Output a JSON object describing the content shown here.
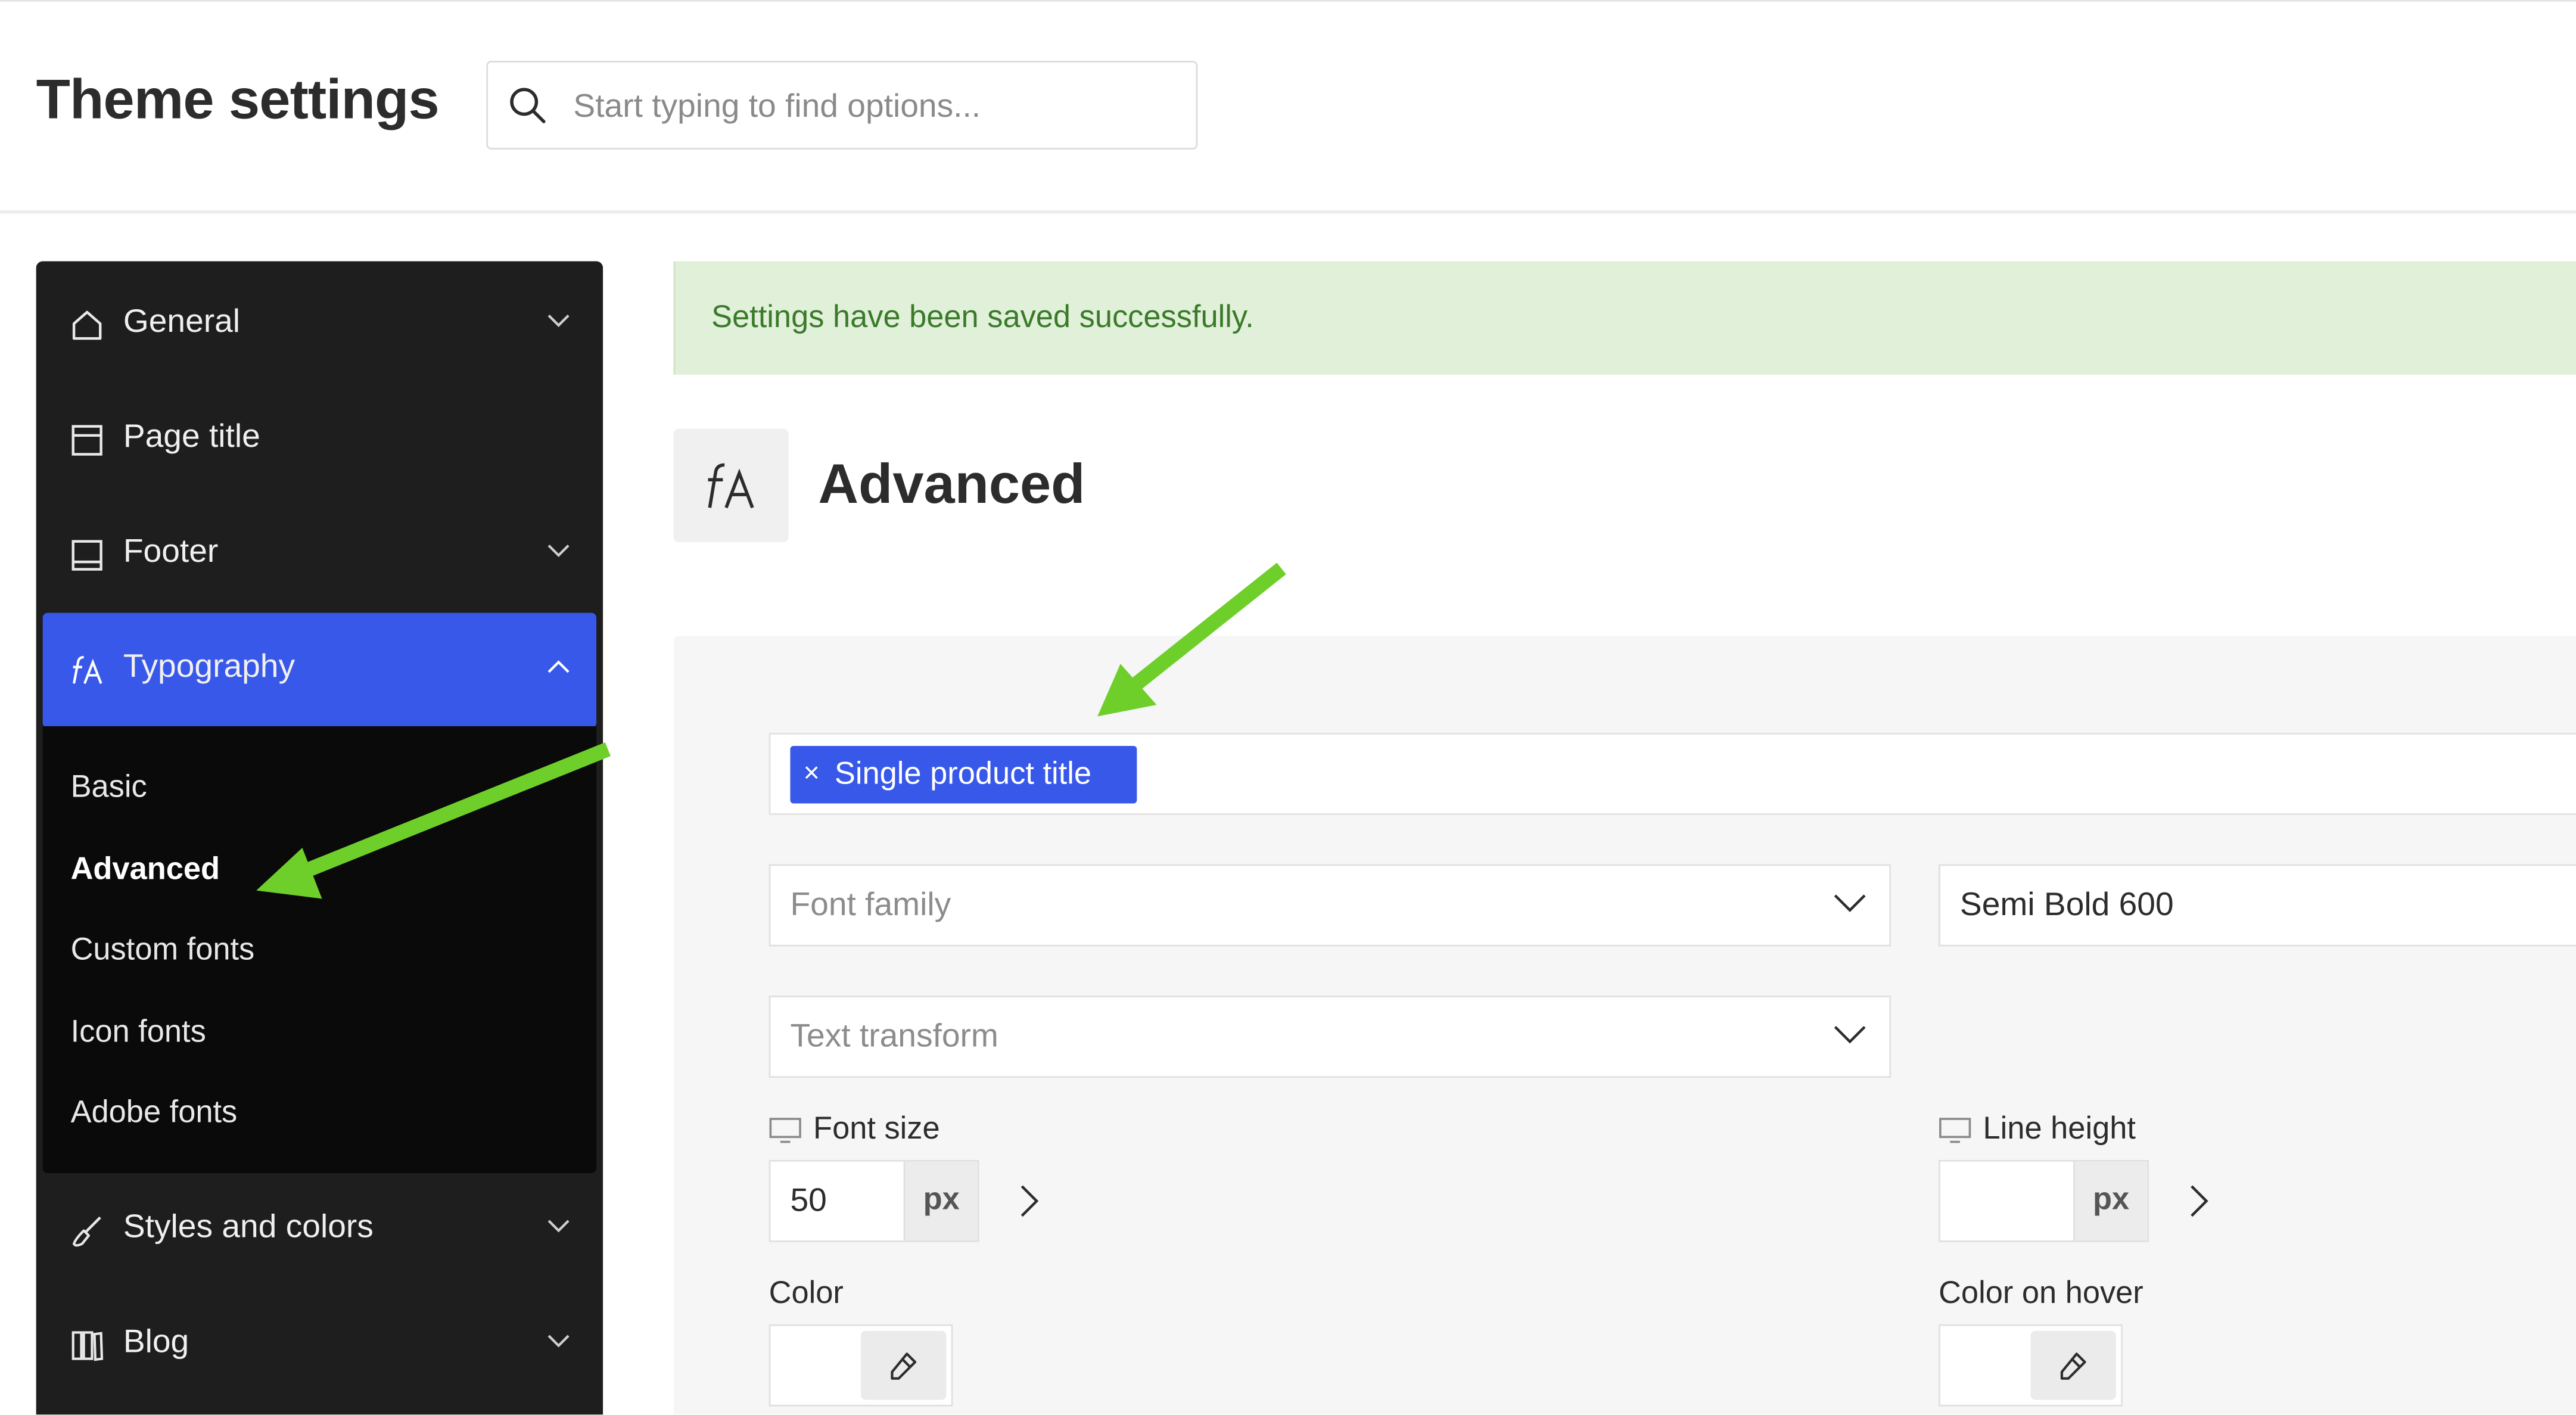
{
  "header": {
    "title": "Theme settings",
    "search": {
      "placeholder": "Start typing to find options..."
    }
  },
  "sidebar": {
    "items": [
      {
        "label": "General",
        "icon": "home-icon",
        "has_dropdown": true
      },
      {
        "label": "Page title",
        "icon": "page-title-icon",
        "has_dropdown": false
      },
      {
        "label": "Footer",
        "icon": "footer-icon",
        "has_dropdown": true
      },
      {
        "label": "Typography",
        "icon": "typography-icon",
        "has_dropdown": true,
        "expanded": true
      },
      {
        "label": "Styles and colors",
        "icon": "brush-icon",
        "has_dropdown": true
      },
      {
        "label": "Blog",
        "icon": "blog-icon",
        "has_dropdown": true
      }
    ],
    "typography_submenu": [
      "Basic",
      "Advanced",
      "Custom fonts",
      "Icon fonts",
      "Adobe fonts"
    ],
    "current_subitem": "Advanced"
  },
  "notice": {
    "text": "Settings have been saved successfully."
  },
  "section": {
    "title": "Advanced",
    "icon": "typography-icon"
  },
  "form": {
    "selected_tag": "Single product title",
    "font_family_placeholder": "Font family",
    "font_weight_value": "Semi Bold 600",
    "text_transform_placeholder": "Text transform",
    "font_size": {
      "label": "Font size",
      "value": "50",
      "unit": "px"
    },
    "line_height": {
      "label": "Line height",
      "value": "",
      "unit": "px"
    },
    "color": {
      "label": "Color"
    },
    "color_hover": {
      "label": "Color on hover"
    }
  },
  "colors": {
    "accent": "#3858e9",
    "sidebar_bg": "#1e1e1e",
    "submenu_bg": "#0a0a0a",
    "notice_bg": "#e1f0d9",
    "notice_text": "#3a7a2a",
    "annotation_arrow": "#6fcf2a"
  }
}
